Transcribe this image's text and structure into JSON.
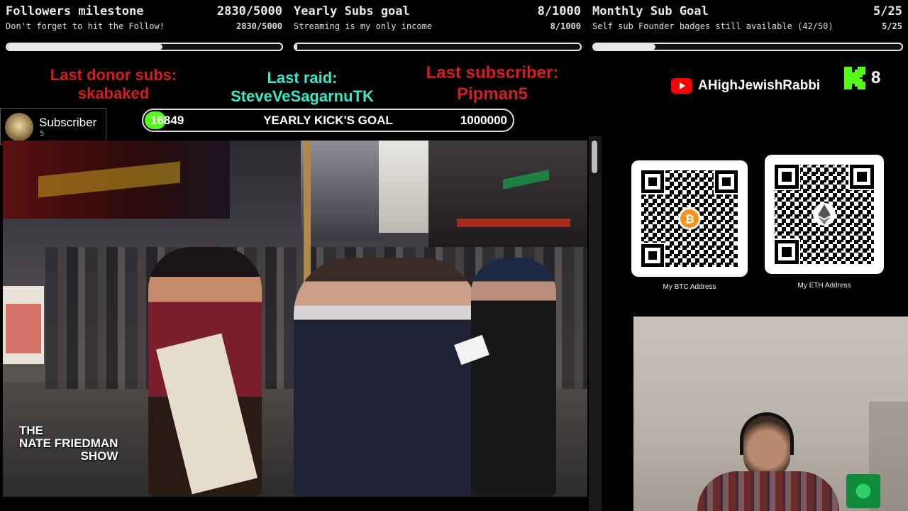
{
  "goals": [
    {
      "title": "Followers milestone",
      "title_value": "2830/5000",
      "subtitle": "Don't forget to hit the Follow!",
      "subtitle_value": "2830/5000",
      "progress": 0.566
    },
    {
      "title": "Yearly Subs goal",
      "title_value": "8/1000",
      "subtitle": "Streaming is my only income",
      "subtitle_value": "8/1000",
      "progress": 0.008
    },
    {
      "title": "Monthly Sub Goal",
      "title_value": "5/25",
      "subtitle": "Self sub Founder badges still available (42/50)",
      "subtitle_value": "5/25",
      "progress": 0.2
    }
  ],
  "alerts": {
    "donor_label": "Last donor subs:",
    "donor_name": "skabaked",
    "raid_label": "Last raid:",
    "raid_name": "SteveVeSagarnuTK",
    "subscriber_label": "Last subscriber:",
    "subscriber_name": "Pipman5"
  },
  "sub_card": {
    "label": "Subscriber",
    "count": "5"
  },
  "kick_goal": {
    "current": "16849",
    "label": "YEARLY KICK'S GOAL",
    "target": "1000000"
  },
  "channel": {
    "youtube_name": "AHighJewishRabbi",
    "kick_count": "8"
  },
  "video": {
    "watermark_line1": "THE",
    "watermark_line2": "NATE FRIEDMAN",
    "watermark_line3": "SHOW"
  },
  "crypto": {
    "btc_label": "My BTC Address",
    "eth_label": "My ETH Address"
  },
  "colors": {
    "red": "#d51d1d",
    "cyan": "#39e8c9",
    "kick_green": "#53fc18",
    "youtube_red": "#ff0000",
    "btc_orange": "#f7931a"
  }
}
